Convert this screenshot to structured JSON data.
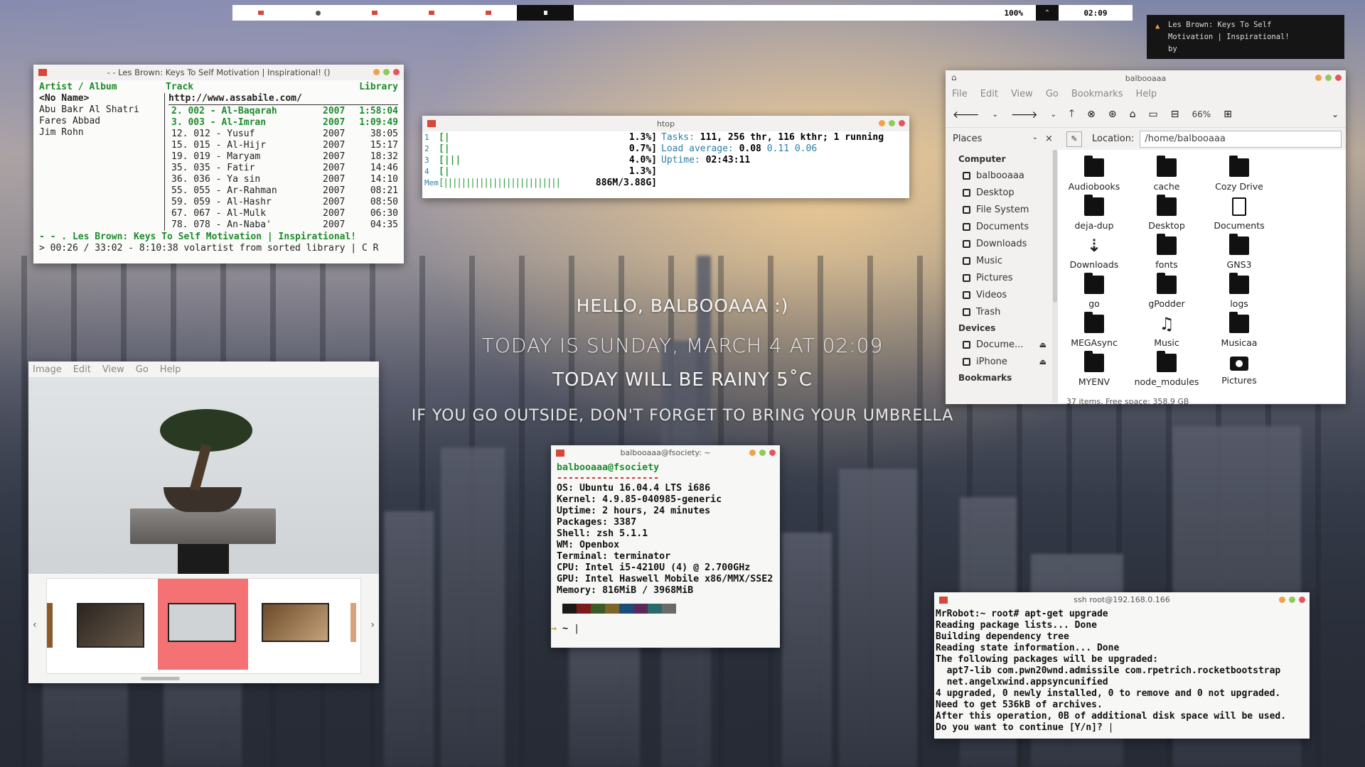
{
  "topbar": {
    "volume": "100%",
    "time": "02:09"
  },
  "notification": {
    "text_line1": "Les Brown: Keys To Self",
    "text_line2": "Motivation | Inspirational!",
    "text_line3": "by"
  },
  "greeting": {
    "hello": "HELLO, BALBOOAAA :)",
    "today": "TODAY IS SUNDAY, MARCH 4 AT 02:09",
    "weather": "TODAY WILL BE RAINY 5˚C",
    "advice": "IF YOU GO OUTSIDE, DON'T FORGET TO BRING YOUR UMBRELLA"
  },
  "cmus": {
    "title": "- - Les Brown: Keys To Self Motivation | Inspirational! ()",
    "col_artist": "Artist / Album",
    "col_track": "Track",
    "col_library": "Library",
    "artists": [
      "<No Name>",
      "Abu Bakr Al Shatri",
      "Fares Abbad",
      "Jim Rohn"
    ],
    "url": "http://www.assabile.com/",
    "tracks": [
      {
        "n": "2. 002 - Al-Baqarah",
        "y": "2007",
        "d": "1:58:04"
      },
      {
        "n": "3. 003 - Al-Imran",
        "y": "2007",
        "d": "1:09:49"
      },
      {
        "n": "12. 012 - Yusuf",
        "y": "2007",
        "d": "38:05"
      },
      {
        "n": "15. 015 - Al-Hijr",
        "y": "2007",
        "d": "15:17"
      },
      {
        "n": "19. 019 - Maryam",
        "y": "2007",
        "d": "18:32"
      },
      {
        "n": "35. 035 - Fatir",
        "y": "2007",
        "d": "14:46"
      },
      {
        "n": "36. 036 - Ya sin",
        "y": "2007",
        "d": "14:10"
      },
      {
        "n": "55. 055 - Ar-Rahman",
        "y": "2007",
        "d": "08:21"
      },
      {
        "n": "59. 059 - Al-Hashr",
        "y": "2007",
        "d": "08:50"
      },
      {
        "n": "67. 067 - Al-Mulk",
        "y": "2007",
        "d": "06:30"
      },
      {
        "n": "78. 078 - An-Naba'",
        "y": "2007",
        "d": "04:35"
      }
    ],
    "now_playing": "- -  . Les Brown: Keys To Self Motivation | Inspirational!",
    "status": "> 00:26 / 33:02 - 8:10:38 volartist from sorted library | C R"
  },
  "htop": {
    "title": "htop",
    "cpus": [
      {
        "id": "1",
        "bar": "[|",
        "pct": "1.3%]"
      },
      {
        "id": "2",
        "bar": "[|",
        "pct": "0.7%]"
      },
      {
        "id": "3",
        "bar": "[|||",
        "pct": "4.0%]"
      },
      {
        "id": "4",
        "bar": "[|",
        "pct": "1.3%]"
      }
    ],
    "mem_label": "Mem",
    "mem_bar": "[||||||||||||||||||||||||||",
    "mem_value": "886M/3.88G]",
    "tasks_label": "Tasks:",
    "tasks_value": "111, 256 thr, 116 kthr; 1 running",
    "load_label": "Load average:",
    "load_1": "0.08",
    "load_rest": "0.11 0.06",
    "uptime_label": "Uptime:",
    "uptime_value": "02:43:11"
  },
  "viewer": {
    "menu": [
      "Image",
      "Edit",
      "View",
      "Go",
      "Help"
    ]
  },
  "fm": {
    "title": "balbooaaa",
    "menu": [
      "File",
      "Edit",
      "View",
      "Go",
      "Bookmarks",
      "Help"
    ],
    "zoom": "66%",
    "places_label": "Places",
    "location_label": "Location:",
    "location_value": "/home/balbooaaa",
    "sections": {
      "computer": "Computer",
      "devices": "Devices",
      "bookmarks": "Bookmarks"
    },
    "computer_items": [
      "balbooaaa",
      "Desktop",
      "File System",
      "Documents",
      "Downloads",
      "Music",
      "Pictures",
      "Videos",
      "Trash"
    ],
    "device_items": [
      "Docume...",
      "iPhone"
    ],
    "items": [
      "Audiobooks",
      "cache",
      "Cozy Drive",
      "deja-dup",
      "Desktop",
      "Documents",
      "Downloads",
      "fonts",
      "GNS3",
      "go",
      "gPodder",
      "logs",
      "MEGAsync",
      "Music",
      "Musicaa",
      "MYENV",
      "node_modules",
      "Pictures"
    ],
    "status": "37 items, Free space: 358.9 GB"
  },
  "neofetch": {
    "title": "balbooaaa@fsociety: ~",
    "user": "balbooaaa@fsociety",
    "rule": "------------------",
    "lines": [
      [
        "OS:",
        "Ubuntu 16.04.4 LTS i686"
      ],
      [
        "Kernel:",
        "4.9.85-040985-generic"
      ],
      [
        "Uptime:",
        "2 hours, 24 minutes"
      ],
      [
        "Packages:",
        "3387"
      ],
      [
        "Shell:",
        "zsh 5.1.1"
      ],
      [
        "WM:",
        "Openbox"
      ],
      [
        "Terminal:",
        "terminator"
      ],
      [
        "CPU:",
        "Intel i5-4210U (4) @ 2.700GHz"
      ],
      [
        "GPU:",
        "Intel Haswell Mobile x86/MMX/SSE2"
      ],
      [
        "Memory:",
        "816MiB / 3968MiB"
      ]
    ],
    "prompt": "~"
  },
  "ssh": {
    "title": "ssh root@192.168.0.166",
    "lines": [
      "MrRobot:~ root# apt-get upgrade",
      "Reading package lists... Done",
      "Building dependency tree",
      "Reading state information... Done",
      "The following packages will be upgraded:",
      "  apt7-lib com.pwn20wnd.admissile com.rpetrich.rocketbootstrap",
      "  net.angelxwind.appsyncunified",
      "4 upgraded, 0 newly installed, 0 to remove and 0 not upgraded.",
      "Need to get 536kB of archives.",
      "After this operation, 0B of additional disk space will be used.",
      "Do you want to continue [Y/n]? "
    ]
  },
  "colors": {
    "accent_red": "#d6473c",
    "term_green": "#1d8c2b",
    "selection_pink": "#f47174"
  }
}
